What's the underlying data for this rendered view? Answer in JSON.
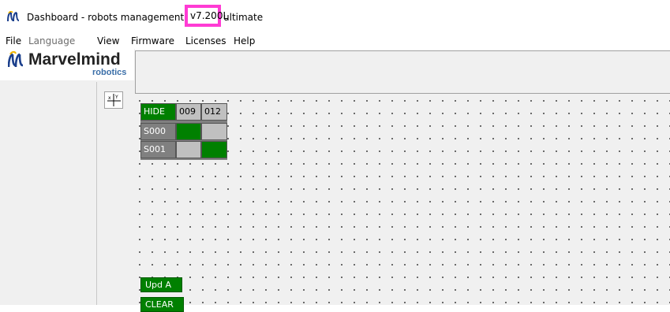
{
  "window": {
    "title_prefix": "Dashboard - robots management",
    "version": "v7.200L",
    "edition": "ultimate"
  },
  "menu": [
    {
      "label": "File",
      "enabled": true
    },
    {
      "label": "Language",
      "enabled": false
    },
    {
      "label": "View",
      "enabled": true
    },
    {
      "label": "Firmware",
      "enabled": true
    },
    {
      "label": "Licenses",
      "enabled": true
    },
    {
      "label": "Help",
      "enabled": true
    }
  ],
  "logo": {
    "name": "Marvelmind",
    "tagline": "robotics"
  },
  "matrix": {
    "hide_label": "HIDE",
    "columns": [
      "009",
      "012"
    ],
    "rows": [
      {
        "label": "S000",
        "cells": [
          "green",
          "gray"
        ]
      },
      {
        "label": "S001",
        "cells": [
          "gray",
          "green"
        ]
      }
    ]
  },
  "buttons": {
    "upd_a": "Upd A",
    "clear": "CLEAR"
  },
  "colors": {
    "highlight_border": "#ff3bd4",
    "active_green": "#008000",
    "inactive_gray": "#c0c0c0",
    "logo_blue": "#3a6ea8"
  },
  "icons": [
    "marvelmind-logo-icon",
    "axis-icon"
  ]
}
